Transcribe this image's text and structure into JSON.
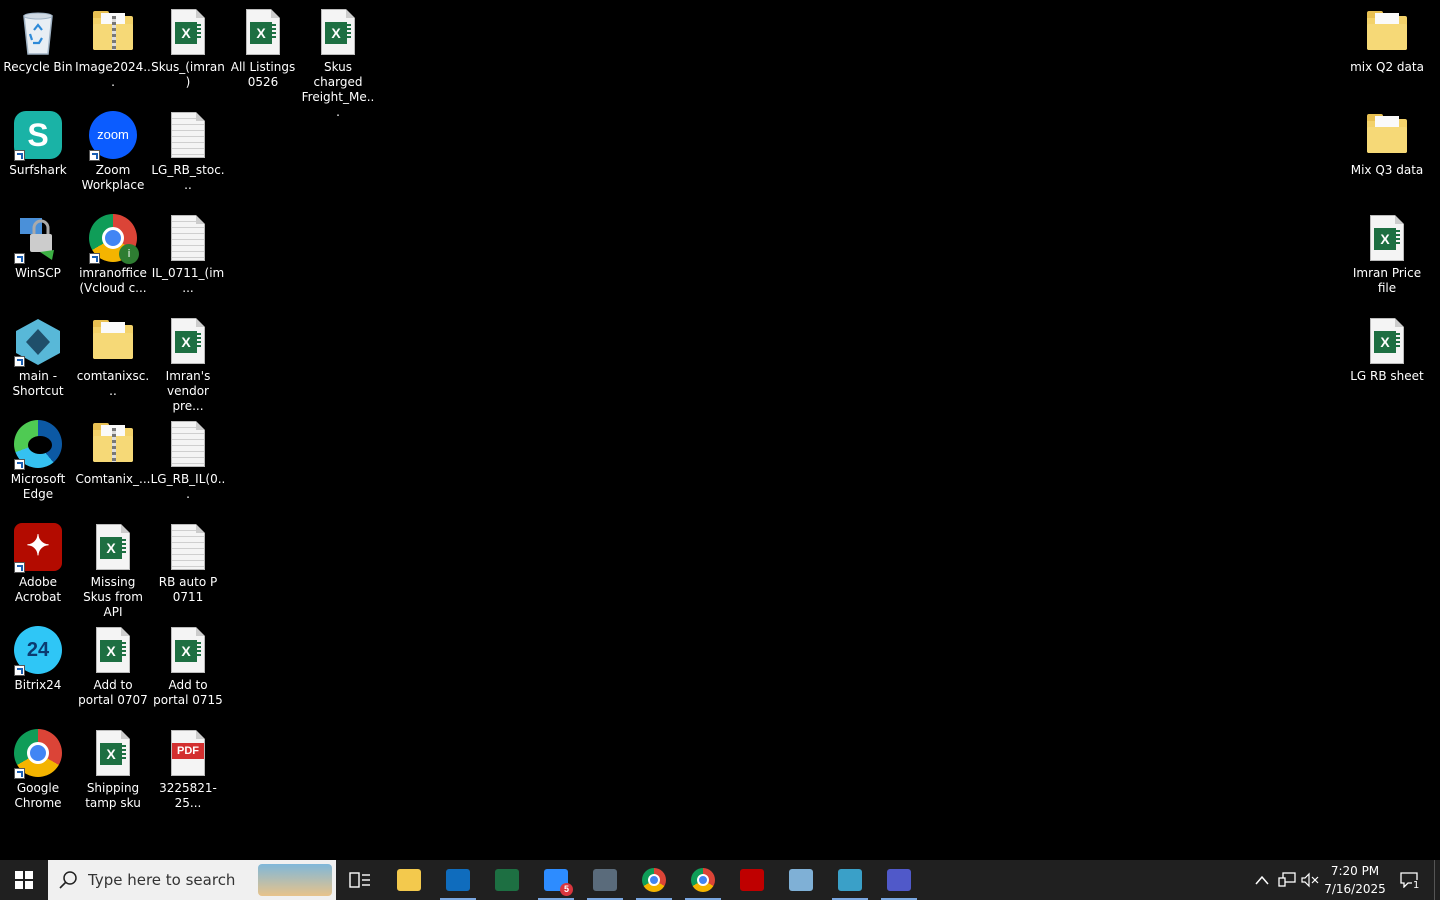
{
  "desktop": {
    "icons": [
      {
        "id": "recycle-bin",
        "label": "Recycle Bin",
        "type": "recycle",
        "col": 0,
        "row": 0
      },
      {
        "id": "image2024",
        "label": "Image2024...",
        "type": "zipfolder",
        "col": 1,
        "row": 0
      },
      {
        "id": "skus-imran",
        "label": "Skus_(imran)",
        "type": "excel",
        "col": 2,
        "row": 0
      },
      {
        "id": "all-listings",
        "label": "All Listings 0526",
        "type": "excel",
        "col": 3,
        "row": 0
      },
      {
        "id": "skus-charged",
        "label": "Skus charged Freight_Me...",
        "type": "excel",
        "col": 4,
        "row": 0
      },
      {
        "id": "surfshark",
        "label": "Surfshark",
        "type": "app",
        "app": "surfshark",
        "col": 0,
        "row": 1
      },
      {
        "id": "zoom",
        "label": "Zoom Workplace",
        "type": "app",
        "app": "zoom",
        "col": 1,
        "row": 1
      },
      {
        "id": "lg-rb-stoc",
        "label": "LG_RB_stoc...",
        "type": "text",
        "col": 2,
        "row": 1
      },
      {
        "id": "winscp",
        "label": "WinSCP",
        "type": "app",
        "app": "winscp",
        "col": 0,
        "row": 2
      },
      {
        "id": "imranoffice",
        "label": "imranoffice (Vcloud c...",
        "type": "app",
        "app": "chrome-profile",
        "col": 1,
        "row": 2
      },
      {
        "id": "il-0711",
        "label": "IL_0711_(im...",
        "type": "text",
        "col": 2,
        "row": 2
      },
      {
        "id": "main-shortcut",
        "label": "main - Shortcut",
        "type": "app",
        "app": "gem",
        "col": 0,
        "row": 3
      },
      {
        "id": "comtanixsc",
        "label": "comtanixsc...",
        "type": "folder",
        "col": 1,
        "row": 3
      },
      {
        "id": "imrans-vendor",
        "label": "Imran's vendor pre...",
        "type": "excel",
        "col": 2,
        "row": 3
      },
      {
        "id": "edge",
        "label": "Microsoft Edge",
        "type": "app",
        "app": "edge",
        "col": 0,
        "row": 4
      },
      {
        "id": "comtanix",
        "label": "Comtanix_...",
        "type": "zipfolder",
        "col": 1,
        "row": 4
      },
      {
        "id": "lg-rb-il",
        "label": "LG_RB_IL(0...",
        "type": "text",
        "col": 2,
        "row": 4
      },
      {
        "id": "acrobat",
        "label": "Adobe Acrobat",
        "type": "app",
        "app": "acrobat",
        "col": 0,
        "row": 5
      },
      {
        "id": "missing-skus",
        "label": "Missing Skus from API",
        "type": "excel",
        "col": 1,
        "row": 5
      },
      {
        "id": "rb-auto",
        "label": "RB auto P 0711",
        "type": "text",
        "col": 2,
        "row": 5
      },
      {
        "id": "bitrix24",
        "label": "Bitrix24",
        "type": "app",
        "app": "bitrix",
        "col": 0,
        "row": 6
      },
      {
        "id": "add-portal-0707",
        "label": "Add to portal 0707",
        "type": "excel",
        "col": 1,
        "row": 6
      },
      {
        "id": "add-portal-0715",
        "label": "Add to portal 0715",
        "type": "excel",
        "col": 2,
        "row": 6
      },
      {
        "id": "chrome",
        "label": "Google Chrome",
        "type": "app",
        "app": "chrome",
        "col": 0,
        "row": 7
      },
      {
        "id": "shipping-tamp",
        "label": "Shipping tamp sku",
        "type": "excel",
        "col": 1,
        "row": 7
      },
      {
        "id": "pdf-3225821",
        "label": "3225821-25...",
        "type": "pdf",
        "col": 2,
        "row": 7
      }
    ],
    "right_icons": [
      {
        "id": "mix-q2",
        "label": "mix Q2 data",
        "type": "folder",
        "row": 0
      },
      {
        "id": "mix-q3",
        "label": "Mix Q3 data",
        "type": "folder",
        "row": 1
      },
      {
        "id": "imran-price",
        "label": "Imran Price file",
        "type": "excel",
        "row": 2
      },
      {
        "id": "lg-rb-sheet",
        "label": "LG RB sheet",
        "type": "excel",
        "row": 3
      }
    ]
  },
  "taskbar": {
    "search_placeholder": "Type here to search",
    "apps": [
      {
        "id": "task-view",
        "name": "task-view-icon",
        "glyph": "▯☰"
      },
      {
        "id": "explorer",
        "name": "file-explorer-icon",
        "color": "#f3c94d"
      },
      {
        "id": "outlook",
        "name": "outlook-icon",
        "color": "#0f6cbd",
        "open": true
      },
      {
        "id": "excel",
        "name": "excel-icon",
        "color": "#1d6f42",
        "glyph": "X"
      },
      {
        "id": "zoom",
        "name": "zoom-icon",
        "color": "#2d8cff",
        "open": true,
        "badge": "5"
      },
      {
        "id": "calculator",
        "name": "calculator-icon",
        "color": "#5a6b7b",
        "open": true
      },
      {
        "id": "chrome1",
        "name": "chrome-icon",
        "open": true
      },
      {
        "id": "chrome2",
        "name": "chrome-icon",
        "open": true
      },
      {
        "id": "filezilla",
        "name": "filezilla-icon",
        "color": "#bf0000",
        "glyph": "Fz"
      },
      {
        "id": "notepad",
        "name": "notepad-icon",
        "color": "#7fb0d6"
      },
      {
        "id": "gem",
        "name": "gem-app-icon",
        "color": "#3aa0c8",
        "open": true
      },
      {
        "id": "teams",
        "name": "teams-icon",
        "color": "#5059c9",
        "open": true
      }
    ],
    "time": "7:20 PM",
    "date": "7/16/2025",
    "notification_count": "1"
  }
}
